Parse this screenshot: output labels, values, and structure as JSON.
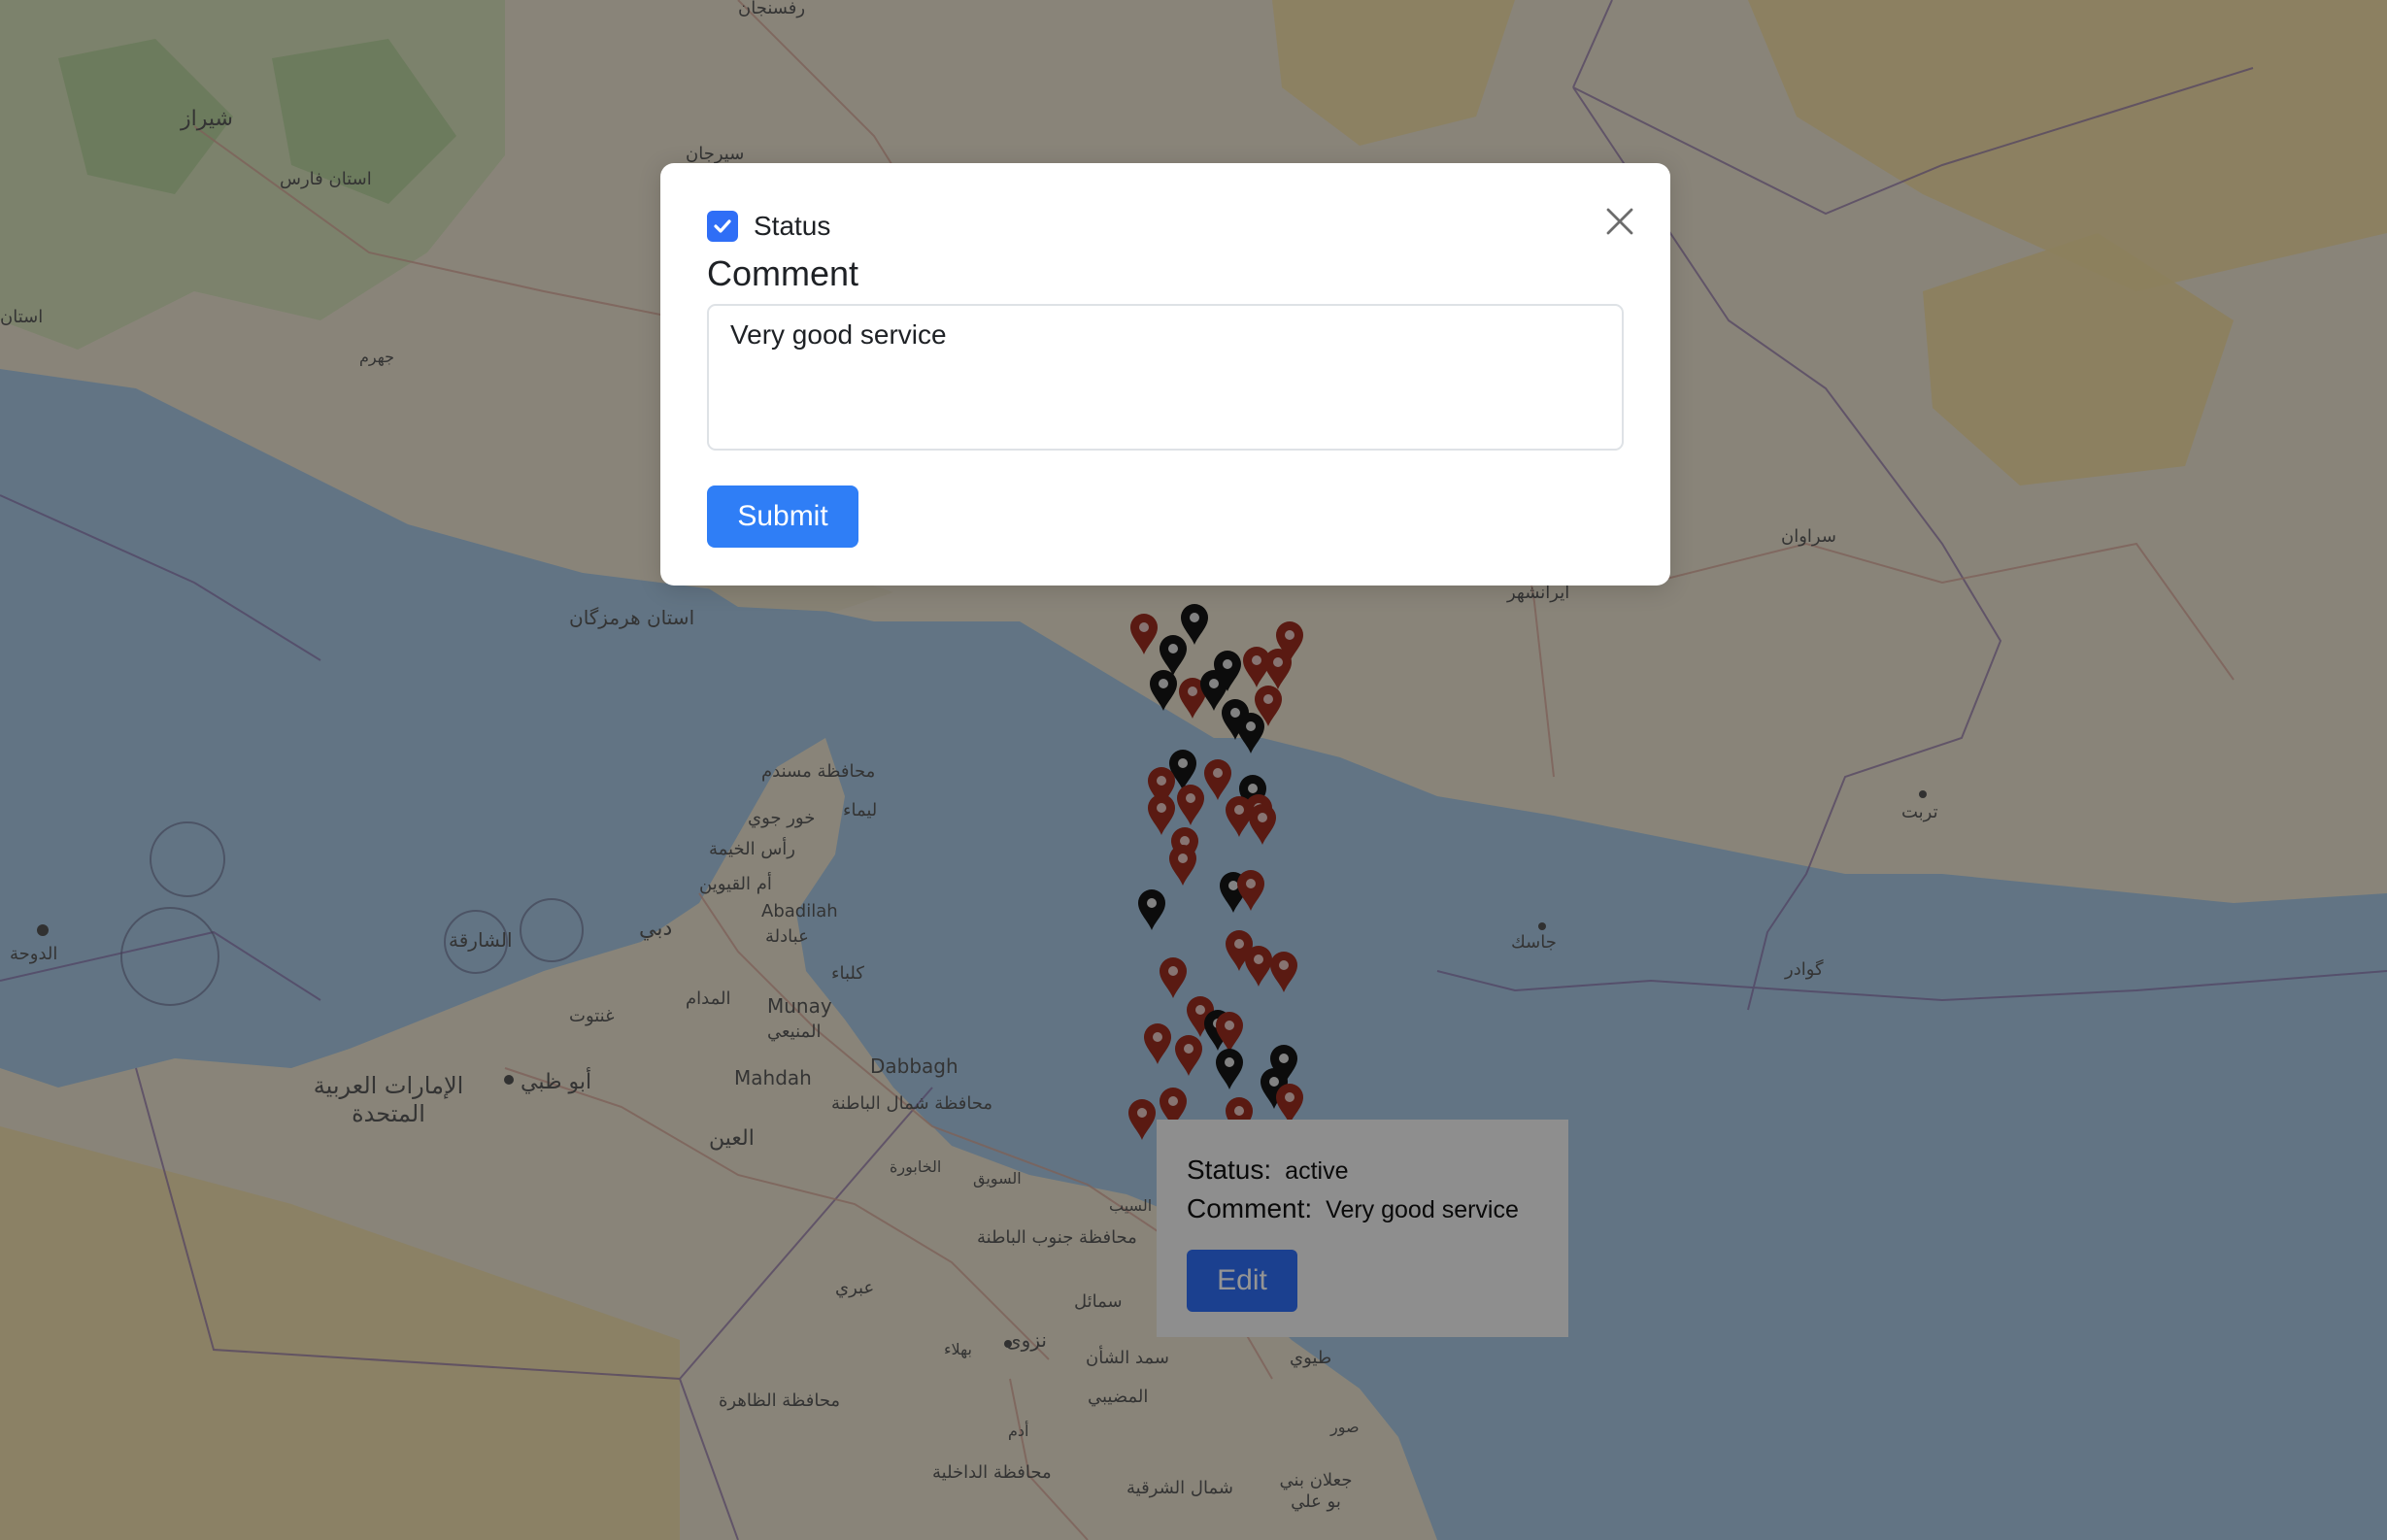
{
  "modal": {
    "status_label": "Status",
    "status_checked": true,
    "comment_label": "Comment",
    "comment_value": "Very good service",
    "submit_label": "Submit"
  },
  "popup": {
    "status_key": "Status:",
    "status_value": "active",
    "comment_key": "Comment:",
    "comment_value": "Very good service",
    "edit_label": "Edit"
  },
  "map_labels": [
    "شیراز",
    "استان فارس",
    "جهرم",
    "سیرجان",
    "رفسنجان",
    "استان",
    "استان هرمزگان",
    "ایرانشهر",
    "سراوان",
    "محافظة مسندم",
    "خور جوي",
    "ليماء",
    "رأس الخيمة",
    "أم القيوين",
    "Abadilah",
    "عبادلة",
    "كلباء",
    "دبي",
    "الشارقة",
    "المدام",
    "غنتوت",
    "Munay",
    "المنيعي",
    "الدوحة",
    "Dabbagh",
    "Mahdah",
    "محافظة شمال الباطنة",
    "الإمارات العربية المتحدة",
    "أبو ظبي",
    "العين",
    "الخابورة",
    "السويق",
    "السيب",
    "محافظة جنوب الباطنة",
    "عبري",
    "سمائل",
    "نزوى",
    "بهلاء",
    "سمد الشأن",
    "طيوي",
    "المضيبي",
    "محافظة الظاهرة",
    "صور",
    "أدم",
    "محافظة الداخلية",
    "شمال الشرقية",
    "جعلان بني بو علي",
    "جاسك",
    "گوادر",
    "تربت"
  ],
  "colors": {
    "marker_red": "#9b2d1f",
    "marker_black": "#151515",
    "primary": "#2f7ef6"
  }
}
